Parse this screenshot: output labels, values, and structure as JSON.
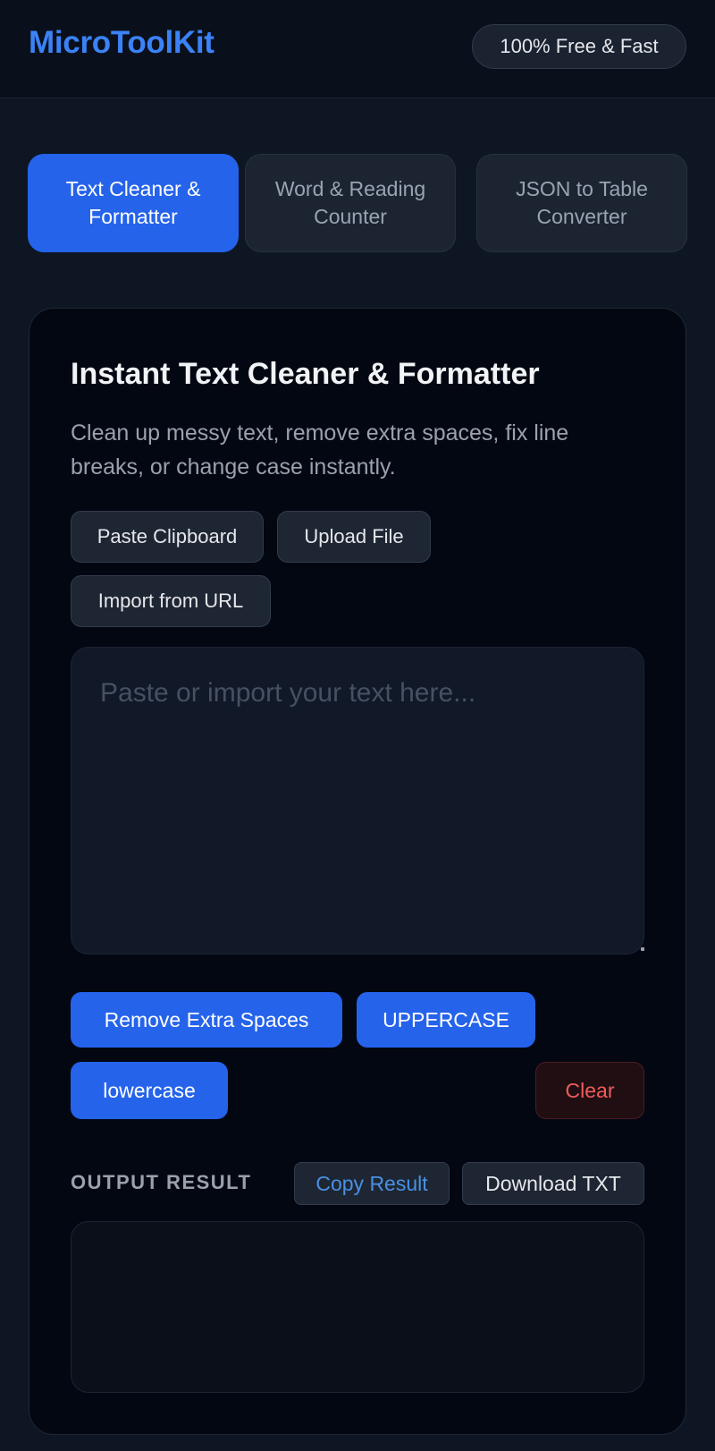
{
  "header": {
    "logo": "MicroToolKit",
    "badge": "100% Free & Fast"
  },
  "tabs": [
    {
      "label": "Text Cleaner & Formatter",
      "active": true
    },
    {
      "label": "Word & Reading Counter",
      "active": false
    },
    {
      "label": "JSON to Table Converter",
      "active": false
    }
  ],
  "tool": {
    "title": "Instant Text Cleaner & Formatter",
    "description": "Clean up messy text, remove extra spaces, fix line breaks, or change case instantly.",
    "source_buttons": {
      "paste": "Paste Clipboard",
      "upload": "Upload File",
      "import_url": "Import from URL"
    },
    "input": {
      "value": "",
      "placeholder": "Paste or import your text here..."
    },
    "actions": {
      "remove_spaces": "Remove Extra Spaces",
      "uppercase": "UPPERCASE",
      "lowercase": "lowercase",
      "clear": "Clear"
    },
    "output": {
      "label": "OUTPUT RESULT",
      "copy": "Copy Result",
      "download": "Download TXT",
      "value": ""
    }
  },
  "colors": {
    "accent": "#2563eb",
    "logo": "#3b82f6",
    "danger": "#ef5b5b",
    "copy_link": "#4a90e2",
    "background": "#0f1623",
    "card": "#030712"
  }
}
